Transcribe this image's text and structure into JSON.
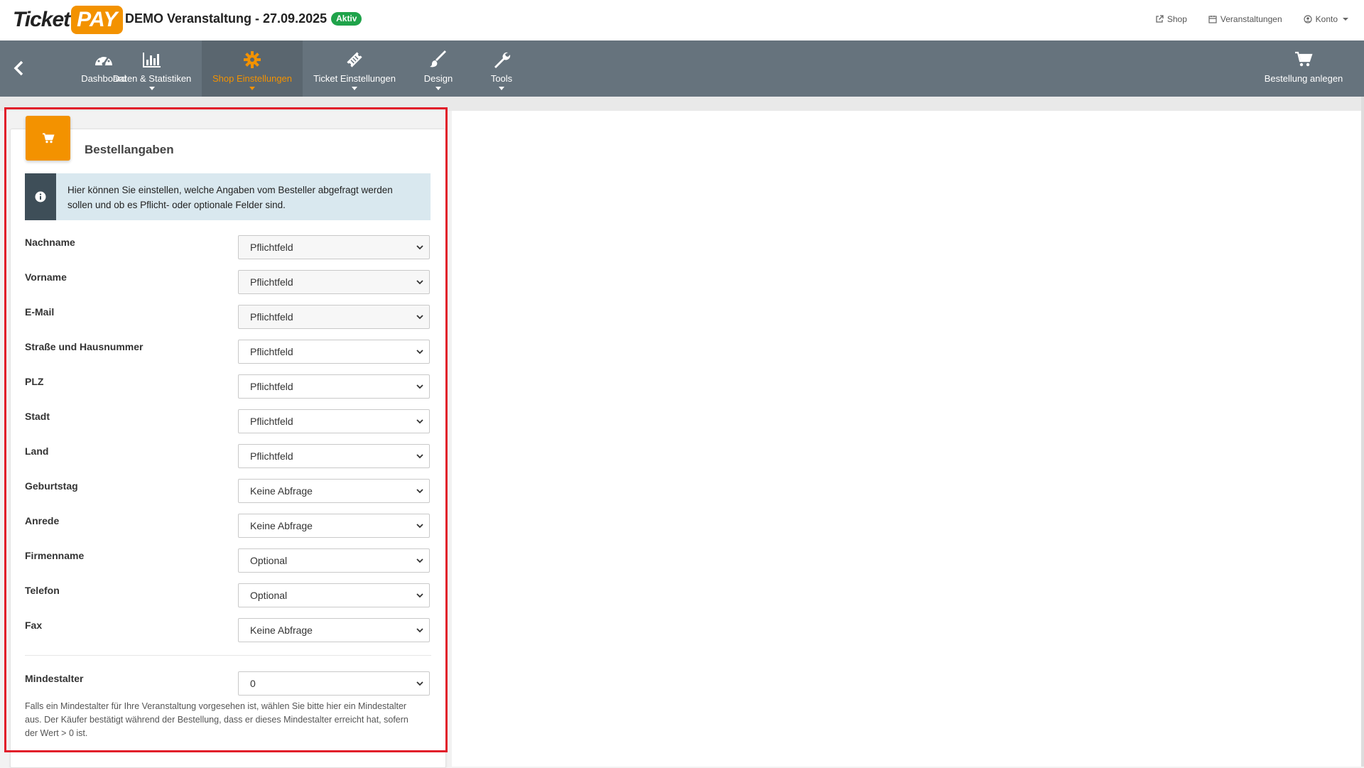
{
  "logo": {
    "part1": "Ticket",
    "part2": "PAY"
  },
  "header": {
    "event_title": "DEMO Veranstaltung - 27.09.2025",
    "status_badge": "Aktiv",
    "links": [
      {
        "label": "Shop",
        "icon": "external-link-icon"
      },
      {
        "label": "Veranstaltungen",
        "icon": "calendar-icon"
      },
      {
        "label": "Konto",
        "icon": "user-circle-icon"
      }
    ]
  },
  "nav": {
    "items": [
      {
        "label": "Dashboard",
        "icon": "dashboard-gauge-icon",
        "dropdown": false
      },
      {
        "label": "Daten & Statistiken",
        "icon": "bar-chart-icon",
        "dropdown": true
      },
      {
        "label": "Shop Einstellungen",
        "icon": "gear-icon",
        "dropdown": true,
        "active": true
      },
      {
        "label": "Ticket Einstellungen",
        "icon": "ticket-icon",
        "dropdown": true
      },
      {
        "label": "Design",
        "icon": "paintbrush-icon",
        "dropdown": true
      },
      {
        "label": "Tools",
        "icon": "wrench-icon",
        "dropdown": true
      }
    ],
    "right_action": {
      "label": "Bestellung anlegen",
      "icon": "shopping-cart-icon"
    }
  },
  "panel": {
    "title": "Bestellangaben",
    "icon": "shopping-cart-icon",
    "info_line1": "Hier können Sie einstellen, welche Angaben vom Besteller abgefragt werden",
    "info_line2": "sollen und ob es Pflicht- oder optionale Felder sind.",
    "fields": [
      {
        "label": "Nachname",
        "value": "Pflichtfeld"
      },
      {
        "label": "Vorname",
        "value": "Pflichtfeld"
      },
      {
        "label": "E-Mail",
        "value": "Pflichtfeld"
      },
      {
        "label": "Straße und Hausnummer",
        "value": "Pflichtfeld"
      },
      {
        "label": "PLZ",
        "value": "Pflichtfeld"
      },
      {
        "label": "Stadt",
        "value": "Pflichtfeld"
      },
      {
        "label": "Land",
        "value": "Pflichtfeld"
      },
      {
        "label": "Geburtstag",
        "value": "Keine Abfrage"
      },
      {
        "label": "Anrede",
        "value": "Keine Abfrage"
      },
      {
        "label": "Firmenname",
        "value": "Optional"
      },
      {
        "label": "Telefon",
        "value": "Optional"
      },
      {
        "label": "Fax",
        "value": "Keine Abfrage"
      }
    ],
    "min_age": {
      "label": "Mindestalter",
      "value": "0",
      "help_line1": "Falls ein Mindestalter für Ihre Veranstaltung vorgesehen ist, wählen Sie bitte hier ein Mindestalter",
      "help_line2": "aus. Der Käufer bestätigt während der Bestellung, dass er dieses Mindestalter erreicht hat, sofern",
      "help_line3": "der Wert > 0 ist."
    }
  },
  "colors": {
    "accent": "#f39200",
    "nav_bg": "#66737d",
    "highlight": "#e11d2a",
    "badge": "#1fa34a"
  }
}
